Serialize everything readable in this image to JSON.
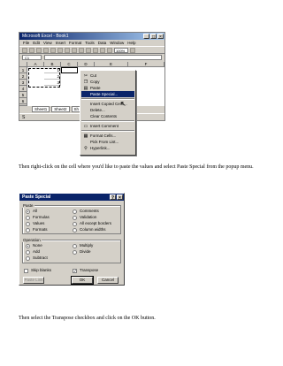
{
  "excel": {
    "title": "Microsoft Excel - Book1",
    "menu": [
      "File",
      "Edit",
      "View",
      "Insert",
      "Format",
      "Tools",
      "Data",
      "Window",
      "Help"
    ],
    "zoom": "100%",
    "name_box": "C1",
    "columns": [
      "A",
      "B",
      "C",
      "D",
      "E",
      "F"
    ],
    "rows": [
      "1",
      "2",
      "3",
      "4",
      "5",
      "6",
      "7"
    ],
    "cells": [
      {
        "col": "A",
        "row": "1",
        "value": "1"
      },
      {
        "col": "A",
        "row": "2",
        "value": "2"
      },
      {
        "col": "A",
        "row": "3",
        "value": "3"
      }
    ],
    "sheet_tabs": [
      "Sheet1",
      "Sheet2",
      "Sh"
    ],
    "status": "S"
  },
  "context_menu": {
    "items": [
      {
        "label": "Cut",
        "icon": "scissors-icon",
        "glyph": "✂"
      },
      {
        "label": "Copy",
        "icon": "copy-icon",
        "glyph": "❐"
      },
      {
        "label": "Paste",
        "icon": "paste-icon",
        "glyph": "▤"
      },
      {
        "label": "Paste Special...",
        "icon": "",
        "glyph": "",
        "highlighted": true
      },
      {
        "separator": true
      },
      {
        "label": "Insert Copied Cells...",
        "icon": "",
        "glyph": ""
      },
      {
        "label": "Delete...",
        "icon": "",
        "glyph": ""
      },
      {
        "label": "Clear Contents",
        "icon": "",
        "glyph": ""
      },
      {
        "separator": true
      },
      {
        "label": "Insert Comment",
        "icon": "comment-icon",
        "glyph": "▭"
      },
      {
        "separator": true
      },
      {
        "label": "Format Cells...",
        "icon": "format-cells-icon",
        "glyph": "▦"
      },
      {
        "label": "Pick From List...",
        "icon": "",
        "glyph": ""
      },
      {
        "label": "Hyperlink...",
        "icon": "hyperlink-icon",
        "glyph": "⚲"
      }
    ]
  },
  "caption1": "Then right-click on the cell where you'd like to paste the values and select Paste Special from the popup menu.",
  "dialog": {
    "title": "Paste Special",
    "paste_label": "Paste",
    "paste_options_left": [
      {
        "label": "All",
        "selected": true
      },
      {
        "label": "Formulas",
        "selected": false
      },
      {
        "label": "Values",
        "selected": false
      },
      {
        "label": "Formats",
        "selected": false
      }
    ],
    "paste_options_right": [
      {
        "label": "Comments",
        "selected": false
      },
      {
        "label": "Validation",
        "selected": false
      },
      {
        "label": "All except borders",
        "selected": false
      },
      {
        "label": "Column widths",
        "selected": false
      }
    ],
    "operation_label": "Operation",
    "operation_left": [
      {
        "label": "None",
        "selected": true
      },
      {
        "label": "Add",
        "selected": false
      },
      {
        "label": "Subtract",
        "selected": false
      }
    ],
    "operation_right": [
      {
        "label": "Multiply",
        "selected": false
      },
      {
        "label": "Divide",
        "selected": false
      }
    ],
    "skip_blanks": {
      "label": "Skip blanks",
      "checked": false
    },
    "transpose": {
      "label": "Transpose",
      "checked": true
    },
    "buttons": {
      "paste_link": "Paste Link",
      "ok": "OK",
      "cancel": "Cancel"
    }
  },
  "caption2": "Then select the Transpose checkbox and click on the OK button."
}
